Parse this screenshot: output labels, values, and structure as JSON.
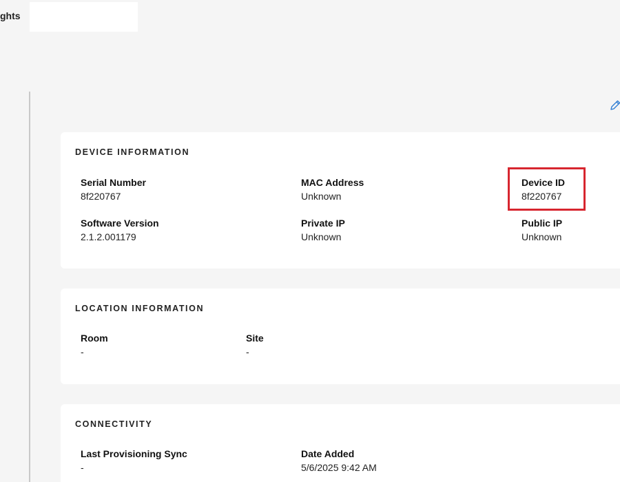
{
  "top": {
    "tab_label": "ghts"
  },
  "icons": {
    "edit": "pencil-edit-icon"
  },
  "device_info": {
    "title": "DEVICE INFORMATION",
    "serial_number": {
      "label": "Serial Number",
      "value": "8f220767"
    },
    "mac_address": {
      "label": "MAC Address",
      "value": "Unknown"
    },
    "device_id": {
      "label": "Device ID",
      "value": "8f220767"
    },
    "software_version": {
      "label": "Software Version",
      "value": "2.1.2.001179"
    },
    "private_ip": {
      "label": "Private IP",
      "value": "Unknown"
    },
    "public_ip": {
      "label": "Public IP",
      "value": "Unknown"
    }
  },
  "location_info": {
    "title": "LOCATION INFORMATION",
    "room": {
      "label": "Room",
      "value": "-"
    },
    "site": {
      "label": "Site",
      "value": "-"
    }
  },
  "connectivity": {
    "title": "CONNECTIVITY",
    "last_provisioning_sync": {
      "label": "Last Provisioning Sync",
      "value": "-"
    },
    "date_added": {
      "label": "Date Added",
      "value": "5/6/2025 9:42 AM"
    }
  },
  "colors": {
    "highlight": "#d7262f",
    "edit_icon": "#2f7dd3",
    "background": "#f5f5f5",
    "card": "#ffffff"
  }
}
